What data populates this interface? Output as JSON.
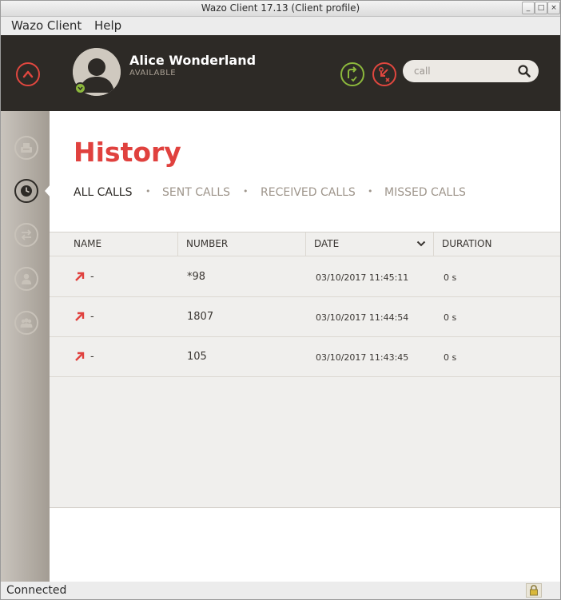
{
  "window": {
    "title": "Wazo Client 17.13 (Client profile)",
    "buttons": [
      "minimize",
      "maximize",
      "close"
    ]
  },
  "menubar": {
    "items": [
      "Wazo Client",
      "Help"
    ]
  },
  "header": {
    "user_name": "Alice Wonderland",
    "user_status": "AVAILABLE",
    "status_color": "#8cb83c",
    "forward_icon_color": "#8cb83c",
    "dnd_icon_color": "#e0473f",
    "search": {
      "placeholder": "call",
      "value": ""
    }
  },
  "sidebar": {
    "items": [
      {
        "icon": "fax-icon",
        "active": false
      },
      {
        "icon": "history-clock-icon",
        "active": true
      },
      {
        "icon": "transfer-icon",
        "active": false
      },
      {
        "icon": "contact-icon",
        "active": false
      },
      {
        "icon": "conference-icon",
        "active": false
      }
    ]
  },
  "main": {
    "title": "History",
    "tabs": [
      {
        "label": "ALL CALLS",
        "active": true
      },
      {
        "label": "SENT CALLS",
        "active": false
      },
      {
        "label": "RECEIVED CALLS",
        "active": false
      },
      {
        "label": "MISSED CALLS",
        "active": false
      }
    ],
    "tab_separator": "•",
    "table": {
      "columns": [
        "NAME",
        "NUMBER",
        "DATE",
        "DURATION"
      ],
      "sorted_column": "DATE",
      "rows": [
        {
          "direction": "outgoing",
          "name": "-",
          "number": "*98",
          "date": "03/10/2017 11:45:11",
          "duration": "0 s"
        },
        {
          "direction": "outgoing",
          "name": "-",
          "number": "1807",
          "date": "03/10/2017 11:44:54",
          "duration": "0 s"
        },
        {
          "direction": "outgoing",
          "name": "-",
          "number": "105",
          "date": "03/10/2017 11:43:45",
          "duration": "0 s"
        }
      ]
    }
  },
  "statusbar": {
    "text": "Connected",
    "icon": "lock-icon"
  },
  "colors": {
    "accent": "#e0413e",
    "header_bg": "#2d2a26",
    "outgoing_arrow": "#e0413e"
  }
}
